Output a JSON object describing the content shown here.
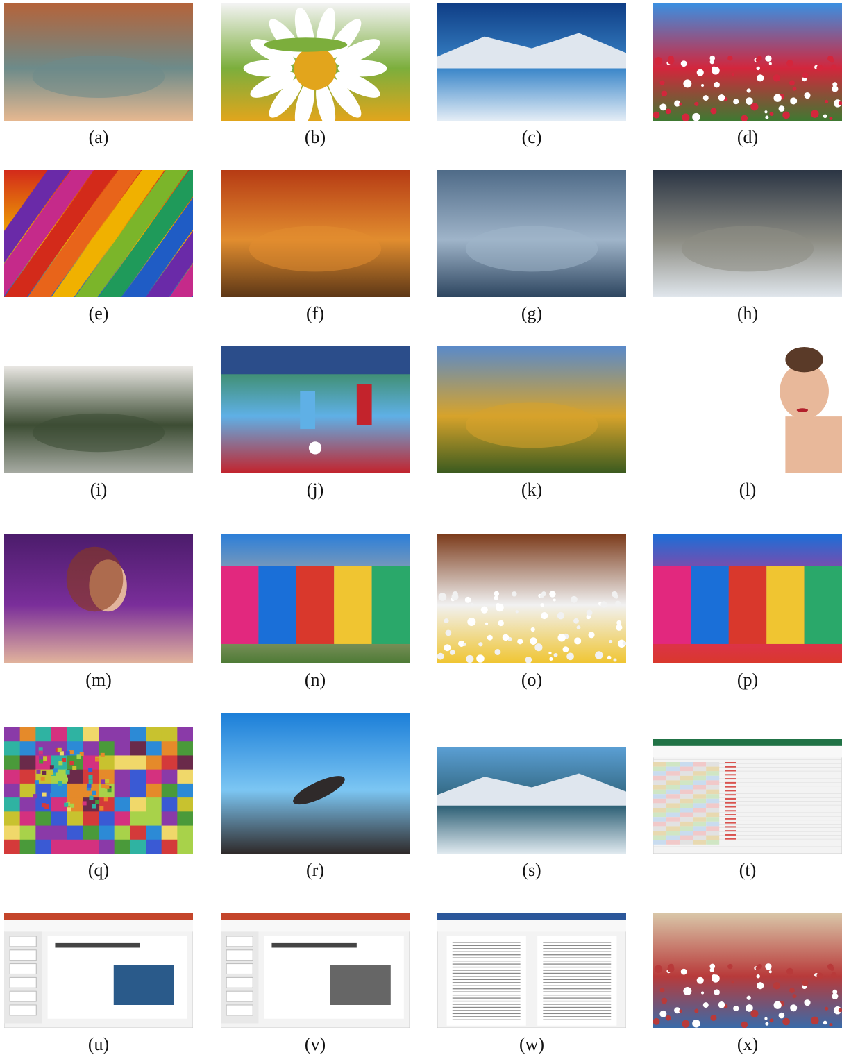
{
  "figure": {
    "captions": [
      "(a)",
      "(b)",
      "(c)",
      "(d)",
      "(e)",
      "(f)",
      "(g)",
      "(h)",
      "(i)",
      "(j)",
      "(k)",
      "(l)",
      "(m)",
      "(n)",
      "(o)",
      "(p)",
      "(q)",
      "(r)",
      "(s)",
      "(t)",
      "(u)",
      "(v)",
      "(w)",
      "(x)"
    ],
    "thumbnails": [
      {
        "icon": "canyon-river-photo",
        "colors": [
          "#b4633a",
          "#6d8b8a",
          "#e7b890"
        ]
      },
      {
        "icon": "grasshopper-daisy-photo",
        "colors": [
          "#f3f3f3",
          "#7cae3c",
          "#e2a51c"
        ]
      },
      {
        "icon": "mountain-lake-photo",
        "colors": [
          "#0f3e86",
          "#3a86c9",
          "#e6eef6"
        ]
      },
      {
        "icon": "flower-field-photo",
        "colors": [
          "#3b8fe1",
          "#d3263c",
          "#3d7a32"
        ]
      },
      {
        "icon": "colored-pencils-photo",
        "colors": [
          "#d32a1a",
          "#f0b100",
          "#1f5cc5"
        ]
      },
      {
        "icon": "autumn-forest-path-photo",
        "colors": [
          "#b63b14",
          "#e18d2f",
          "#5d3716"
        ]
      },
      {
        "icon": "sand-footprints-photo",
        "colors": [
          "#4f6b88",
          "#9fb4c9",
          "#2e4660"
        ]
      },
      {
        "icon": "stormy-sea-photo",
        "colors": [
          "#2b3544",
          "#8c8c83",
          "#e0e6ec"
        ]
      },
      {
        "icon": "foggy-forest-photo",
        "colors": [
          "#e8e6e2",
          "#3d4d34",
          "#a7aba3"
        ]
      },
      {
        "icon": "soccer-match-photo",
        "colors": [
          "#2c7a2a",
          "#5fb0e6",
          "#c3232c"
        ]
      },
      {
        "icon": "autumn-lake-reflection-photo",
        "colors": [
          "#5a8ac9",
          "#d7a32b",
          "#3a5a1f"
        ]
      },
      {
        "icon": "woman-portrait-photo",
        "colors": [
          "#ffffff",
          "#e8b89a",
          "#b21f2b"
        ]
      },
      {
        "icon": "woman-purple-fabric-photo",
        "colors": [
          "#4b1c6b",
          "#7a2e9a",
          "#e2b49c"
        ]
      },
      {
        "icon": "town-square-cafe-photo",
        "colors": [
          "#2b7ed9",
          "#c9b59a",
          "#4d7a35"
        ]
      },
      {
        "icon": "flower-vase-photo",
        "colors": [
          "#7b3a1a",
          "#f1f1f1",
          "#f0c531"
        ]
      },
      {
        "icon": "colorful-houses-photo",
        "colors": [
          "#1a6fd8",
          "#e2287e",
          "#d9382c"
        ]
      },
      {
        "icon": "color-mosaic-pattern",
        "colors": [
          "#c8c22f",
          "#4a9a3a",
          "#d4317f"
        ]
      },
      {
        "icon": "swimming-pool-photo",
        "colors": [
          "#1b7ed8",
          "#7cc6f3",
          "#2f2a2a"
        ]
      },
      {
        "icon": "lake-island-mountains-photo",
        "colors": [
          "#5b9fd4",
          "#2c5f74",
          "#dfe9ef"
        ]
      },
      {
        "icon": "spreadsheet-screenshot",
        "colors": [
          "#217346",
          "#ffffff",
          "#d9534f"
        ]
      },
      {
        "icon": "presentation-screenshot",
        "colors": [
          "#c4452a",
          "#ffffff",
          "#2a5a8a"
        ]
      },
      {
        "icon": "presentation-screenshot",
        "colors": [
          "#c4452a",
          "#ffffff",
          "#666666"
        ]
      },
      {
        "icon": "document-screenshot",
        "colors": [
          "#2b579a",
          "#ffffff",
          "#888888"
        ]
      },
      {
        "icon": "crowded-beach-photo",
        "colors": [
          "#d9c6a8",
          "#b83a3a",
          "#3a6aa8"
        ]
      }
    ]
  }
}
